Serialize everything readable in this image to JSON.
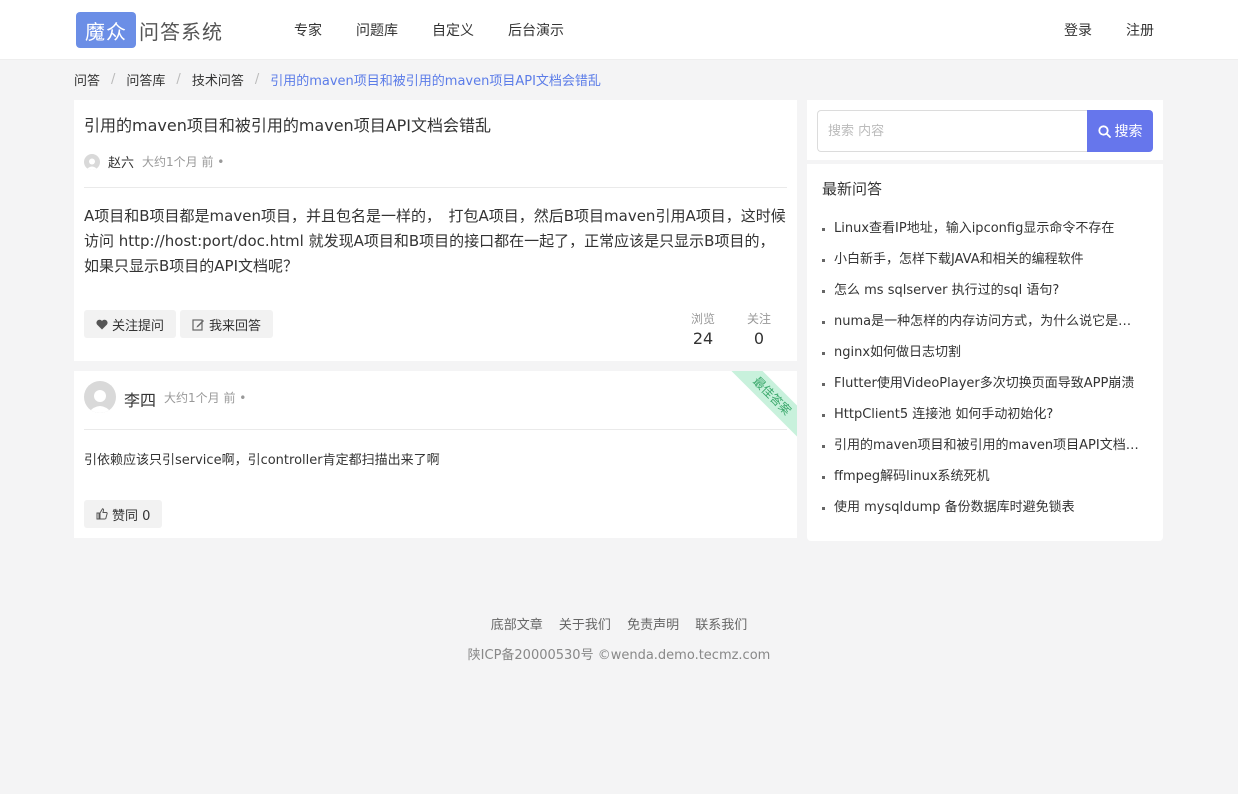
{
  "header": {
    "logo_box": "魔众",
    "logo_text": "问答系统",
    "nav": [
      "专家",
      "问题库",
      "自定义",
      "后台演示"
    ],
    "login": "登录",
    "register": "注册"
  },
  "breadcrumb": [
    "问答",
    "问答库",
    "技术问答",
    "引用的maven项目和被引用的maven项目API文档会错乱"
  ],
  "question": {
    "title": "引用的maven项目和被引用的maven项目API文档会错乱",
    "author": "赵六",
    "time": "大约1个月 前 •",
    "body": "A项目和B项目都是maven项目，并且包名是一样的，　打包A项目，然后B项目maven引用A项目，这时候访问 http://host:port/doc.html 就发现A项目和B项目的接口都在一起了，正常应该是只显示B项目的，如果只显示B项目的API文档呢？",
    "follow_label": "关注提问",
    "answer_label": "我来回答",
    "views_label": "浏览",
    "views": "24",
    "follows_label": "关注",
    "follows": "0"
  },
  "answer": {
    "author": "李四",
    "time": "大约1个月 前 •",
    "ribbon": "最佳答案",
    "body": "引依赖应该只引service啊，引controller肯定都扫描出来了啊",
    "like_label": "赞同 0"
  },
  "search": {
    "placeholder": "搜索 内容",
    "button": "搜索"
  },
  "latest": {
    "title": "最新问答",
    "items": [
      "Linux查看IP地址，输入ipconfig显示命令不存在",
      "小白新手，怎样下载JAVA和相关的编程软件",
      "怎么 ms sqlserver 执行过的sql 语句?",
      "numa是一种怎样的内存访问方式，为什么说它是为多核处理器设计的",
      "nginx如何做日志切割",
      "Flutter使用VideoPlayer多次切换页面导致APP崩溃",
      "HttpClient5 连接池 如何手动初始化?",
      "引用的maven项目和被引用的maven项目API文档会错乱",
      "ffmpeg解码linux系统死机",
      "使用 mysqldump 备份数据库时避免锁表"
    ]
  },
  "footer": {
    "links": [
      "底部文章",
      "关于我们",
      "免责声明",
      "联系我们"
    ],
    "icp": "陕ICP备20000530号 ©wenda.demo.tecmz.com"
  },
  "colors": {
    "accent": "#6676ec",
    "logo": "#6b8ee6",
    "breadcrumb_current": "#5b7ce8",
    "ribbon_bg": "#c8f1dc"
  }
}
